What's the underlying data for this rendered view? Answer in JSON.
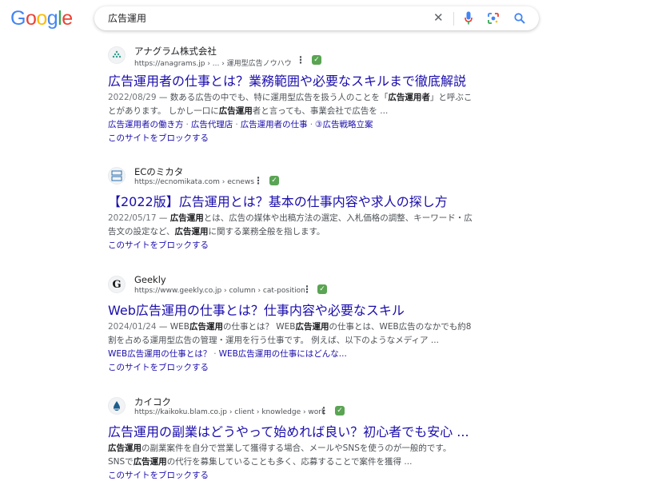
{
  "logo": {
    "letters": [
      "G",
      "o",
      "o",
      "g",
      "l",
      "e"
    ],
    "colors": [
      "#4285F4",
      "#EA4335",
      "#FBBC05",
      "#4285F4",
      "#34A853",
      "#EA4335"
    ]
  },
  "search": {
    "query": "広告運用",
    "clear_icon": "close-icon",
    "voice_icon": "mic-icon",
    "lens_icon": "lens-icon",
    "search_icon": "search-icon"
  },
  "results": [
    {
      "site_name": "アナグラム株式会社",
      "url": "https://anagrams.jp",
      "breadcrumb": " › ... › 運用型広告ノウハウ",
      "title": "広告運用者の仕事とは？業務範囲や必要なスキルまで徹底解説",
      "date": "2022/08/29",
      "snippet_l1_a": "数ある広告の中でも、特に運用型広告を扱う人のことを「",
      "snippet_l1_b": "広告運用者",
      "snippet_l1_c": "」と呼ぶこ",
      "snippet_l2_a": "とがあります。 しかし一口に",
      "snippet_l2_b": "広告運用",
      "snippet_l2_c": "者と言っても、事業会社で広告を ...",
      "sitelinks": [
        "広告運用者の働き方",
        "広告代理店",
        "広告運用者の仕事",
        "③広告戦略立案"
      ],
      "block_label": "このサイトをブロックする"
    },
    {
      "site_name": "ECのミカタ",
      "url": "https://ecnomikata.com",
      "breadcrumb": " › ecnews",
      "title": "【2022版】広告運用とは？基本の仕事内容や求人の探し方",
      "date": "2022/05/17",
      "snippet_l1_b": "広告運用",
      "snippet_l1_c": "とは、広告の媒体や出稿方法の選定、入札価格の調整、キーワード・広",
      "snippet_l2_a": "告文の設定など、",
      "snippet_l2_b": "広告運用",
      "snippet_l2_c": "に関する業務全般を指します。",
      "block_label": "このサイトをブロックする"
    },
    {
      "site_name": "Geekly",
      "url": "https://www.geekly.co.jp",
      "breadcrumb": " › column › cat-position",
      "title": "Web広告運用の仕事とは？仕事内容や必要なスキル",
      "date": "2024/01/24",
      "snippet_l1_a": "WEB",
      "snippet_l1_b": "広告運用",
      "snippet_l1_c": "の仕事とは？ WEB",
      "snippet_l1_d": "広告運用",
      "snippet_l1_e": "の仕事とは、WEB広告のなかでも約8",
      "snippet_l2": "割を占める運用型広告の管理・運用を行う仕事です。 例えば、以下のようなメディア ...",
      "sitelinks": [
        "WEB広告運用の仕事とは？",
        "WEB広告運用の仕事にはどんな..."
      ],
      "block_label": "このサイトをブロックする"
    },
    {
      "site_name": "カイコク",
      "url": "https://kaikoku.blam.co.jp",
      "breadcrumb": " › client › knowledge › work",
      "title": "広告運用の副業はどうやって始めれば良い？初心者でも安心 ...",
      "snippet_l1_b": "広告運用",
      "snippet_l1_c": "の副業案件を自分で営業して獲得する場合、メールやSNSを使うのが一般的です。",
      "snippet_l2_a": "SNSで",
      "snippet_l2_b": "広告運用",
      "snippet_l2_c": "の代行を募集していることも多く、応募することで案件を獲得 ...",
      "block_label": "このサイトをブロックする"
    }
  ],
  "verified_badge": "✓",
  "more_icon": "⋮"
}
